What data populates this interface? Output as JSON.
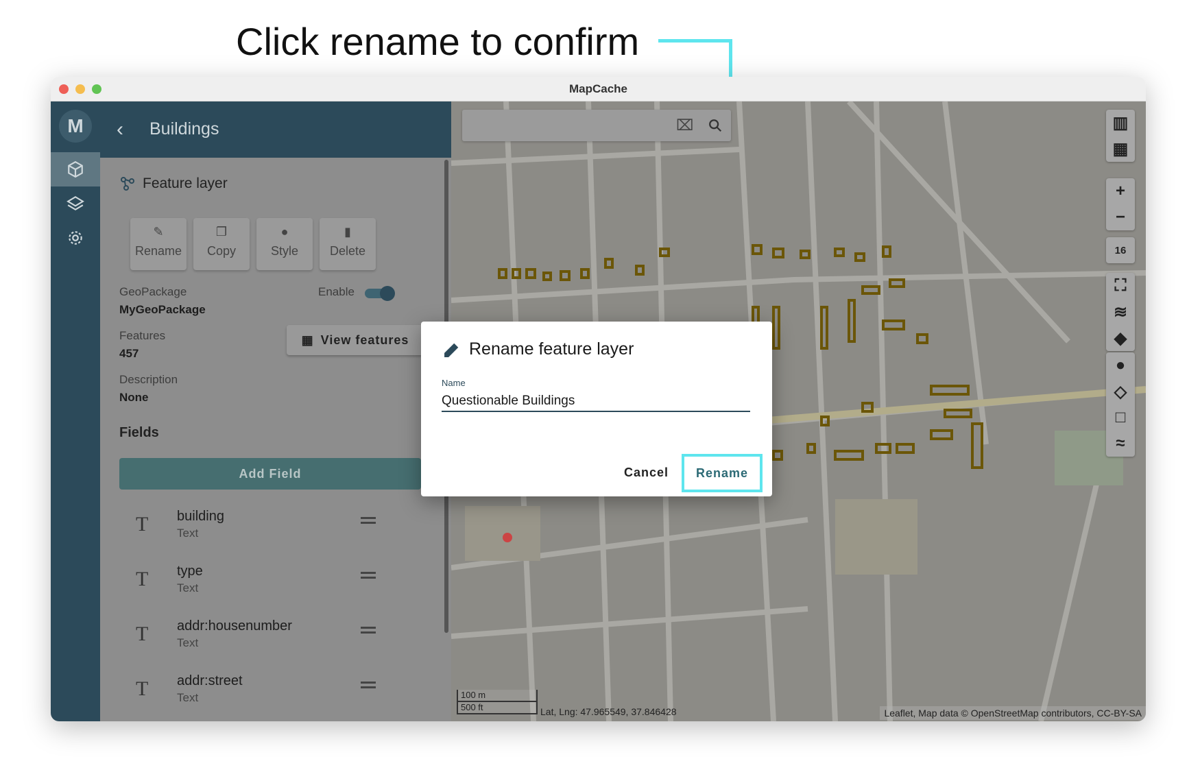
{
  "annotation": {
    "caption": "Click rename to confirm"
  },
  "window": {
    "title": "MapCache"
  },
  "panel": {
    "header_title": "Buildings",
    "section_title": "Feature layer",
    "actions": [
      {
        "label": "Rename",
        "icon": "pencil-icon"
      },
      {
        "label": "Copy",
        "icon": "copy-icon"
      },
      {
        "label": "Style",
        "icon": "palette-icon"
      },
      {
        "label": "Delete",
        "icon": "trash-icon"
      }
    ],
    "geopackage_label": "GeoPackage",
    "geopackage_value": "MyGeoPackage",
    "enable_label": "Enable",
    "features_label": "Features",
    "features_value": "457",
    "view_features_label": "View features",
    "description_label": "Description",
    "description_value": "None",
    "fields_title": "Fields",
    "add_field_label": "Add Field",
    "fields": [
      {
        "name": "building",
        "type": "Text"
      },
      {
        "name": "type",
        "type": "Text"
      },
      {
        "name": "addr:housenumber",
        "type": "Text"
      },
      {
        "name": "addr:street",
        "type": "Text"
      }
    ]
  },
  "map": {
    "zoom_level": "16",
    "scale_m": "100 m",
    "scale_ft": "500 ft",
    "latlng": "Lat, Lng: 47.965549, 37.846428",
    "attribution": "Leaflet, Map data © OpenStreetMap contributors, CC-BY-SA"
  },
  "dialog": {
    "title": "Rename feature layer",
    "field_label": "Name",
    "field_value": "Questionable Buildings",
    "cancel_label": "Cancel",
    "rename_label": "Rename"
  },
  "colors": {
    "header": "#2c4a5a",
    "callout": "#5ee5ee",
    "add_field": "#466e70"
  }
}
